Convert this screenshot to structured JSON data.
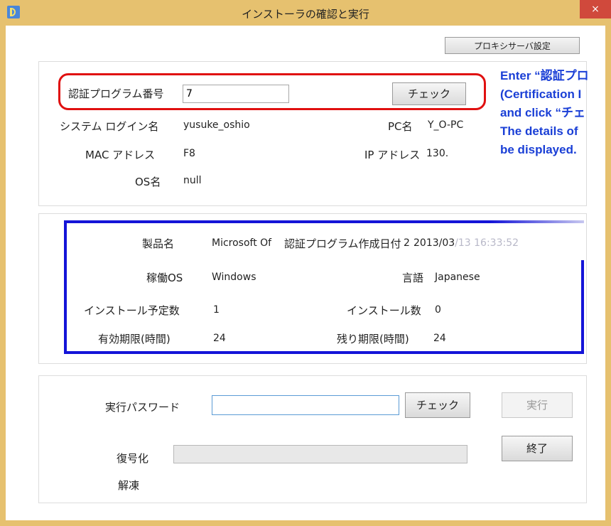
{
  "window": {
    "title": "インストーラの確認と実行",
    "close_glyph": "×"
  },
  "toolbar": {
    "proxy_label": "プロキシサーバ設定"
  },
  "cert": {
    "program_no_label": "認証プログラム番号",
    "program_no_value": "7",
    "check_label": "チェック",
    "login_label": "システム ログイン名",
    "login_value": "yusuke_oshio",
    "pc_label": "PC名",
    "pc_value": "Y_O-PC",
    "mac_label": "MAC アドレス",
    "mac_value": "F8",
    "ip_label": "IP アドレス",
    "ip_value": "130.",
    "os_label": "OS名",
    "os_value": "null"
  },
  "details": {
    "product_label": "製品名",
    "product_value": "Microsoft Of",
    "created_label": "認証プログラム作成日付",
    "created_value_cut": "2",
    "created_value": "2013/03",
    "created_value_faded": "/13 16:33:52",
    "os_label": "稼働OS",
    "os_value": "Windows",
    "lang_label": "言語",
    "lang_value": "Japanese",
    "planned_label": "インストール予定数",
    "planned_value": "1",
    "installed_label": "インストール数",
    "installed_value": "0",
    "valid_label": "有効期限(時間)",
    "valid_value": "24",
    "remain_label": "残り期限(時間)",
    "remain_value": "24"
  },
  "exec": {
    "password_label": "実行パスワード",
    "password_value": "",
    "check_label": "チェック",
    "run_label": "実行",
    "exit_label": "終了",
    "decrypt_label": "復号化",
    "unfreeze_label": "解凍"
  },
  "annotation": {
    "line1": "Enter “認証プロ",
    "line2": "(Certification I",
    "line3": "and click “チェ",
    "line4": "The details of",
    "line5": "be displayed."
  },
  "colors": {
    "title_bar": "#e6c16f",
    "close_button": "#d0493c",
    "highlight_red": "#e01010",
    "highlight_blue": "#1414d8",
    "annotation_text": "#1a3fd6"
  }
}
